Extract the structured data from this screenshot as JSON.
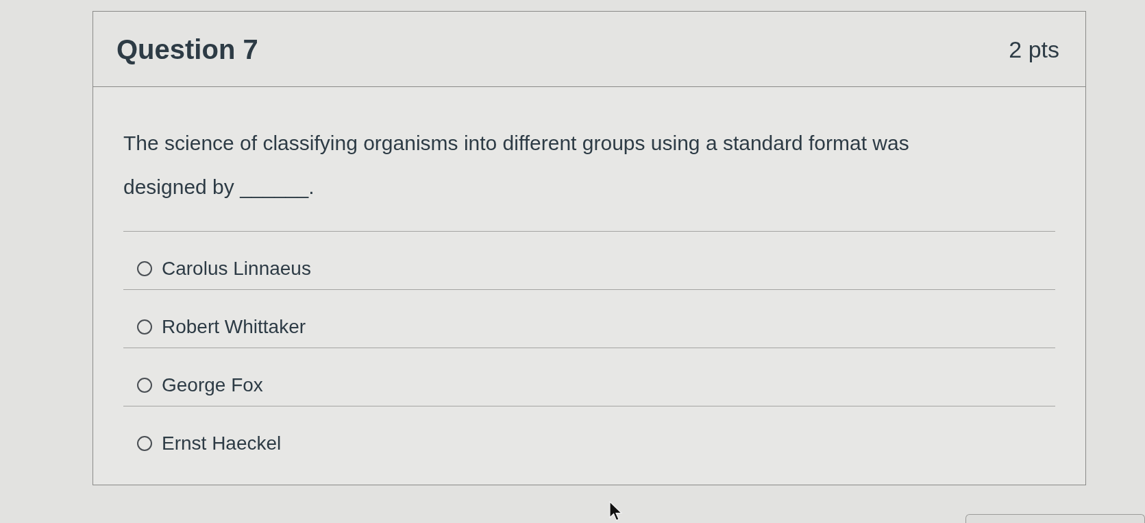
{
  "question": {
    "title": "Question 7",
    "points": "2 pts",
    "text": "The science of classifying organisms into different groups using a standard format was designed by ______."
  },
  "answers": [
    {
      "label": "Carolus Linnaeus",
      "selected": false
    },
    {
      "label": "Robert Whittaker",
      "selected": false
    },
    {
      "label": "George Fox",
      "selected": false
    },
    {
      "label": "Ernst Haeckel",
      "selected": false
    }
  ]
}
